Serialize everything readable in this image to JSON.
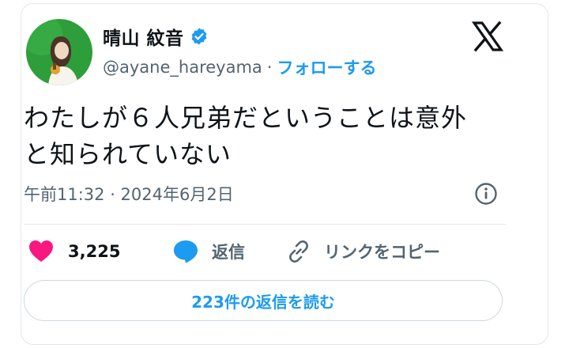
{
  "author": {
    "display_name": "晴山 紋音",
    "handle": "@ayane_hareyama",
    "separator": "·",
    "follow_label": "フォローする"
  },
  "tweet": {
    "text_line1": "わたしが６人兄弟だということは意外",
    "text_line2": "と知られていない",
    "timestamp": "午前11:32 · 2024年6月2日"
  },
  "actions": {
    "like_count": "3,225",
    "reply_label": "返信",
    "copy_link_label": "リンクをコピー"
  },
  "replies_button_label": "223件の返信を読む",
  "colors": {
    "accent": "#1d9bf0",
    "like": "#f91880",
    "avatar_background": "#2e9e3a",
    "text": "#0f1419",
    "secondary_text": "#536471"
  },
  "icons": [
    "verified-badge-icon",
    "x-logo-icon",
    "info-icon",
    "heart-icon",
    "reply-bubble-icon",
    "link-icon"
  ]
}
